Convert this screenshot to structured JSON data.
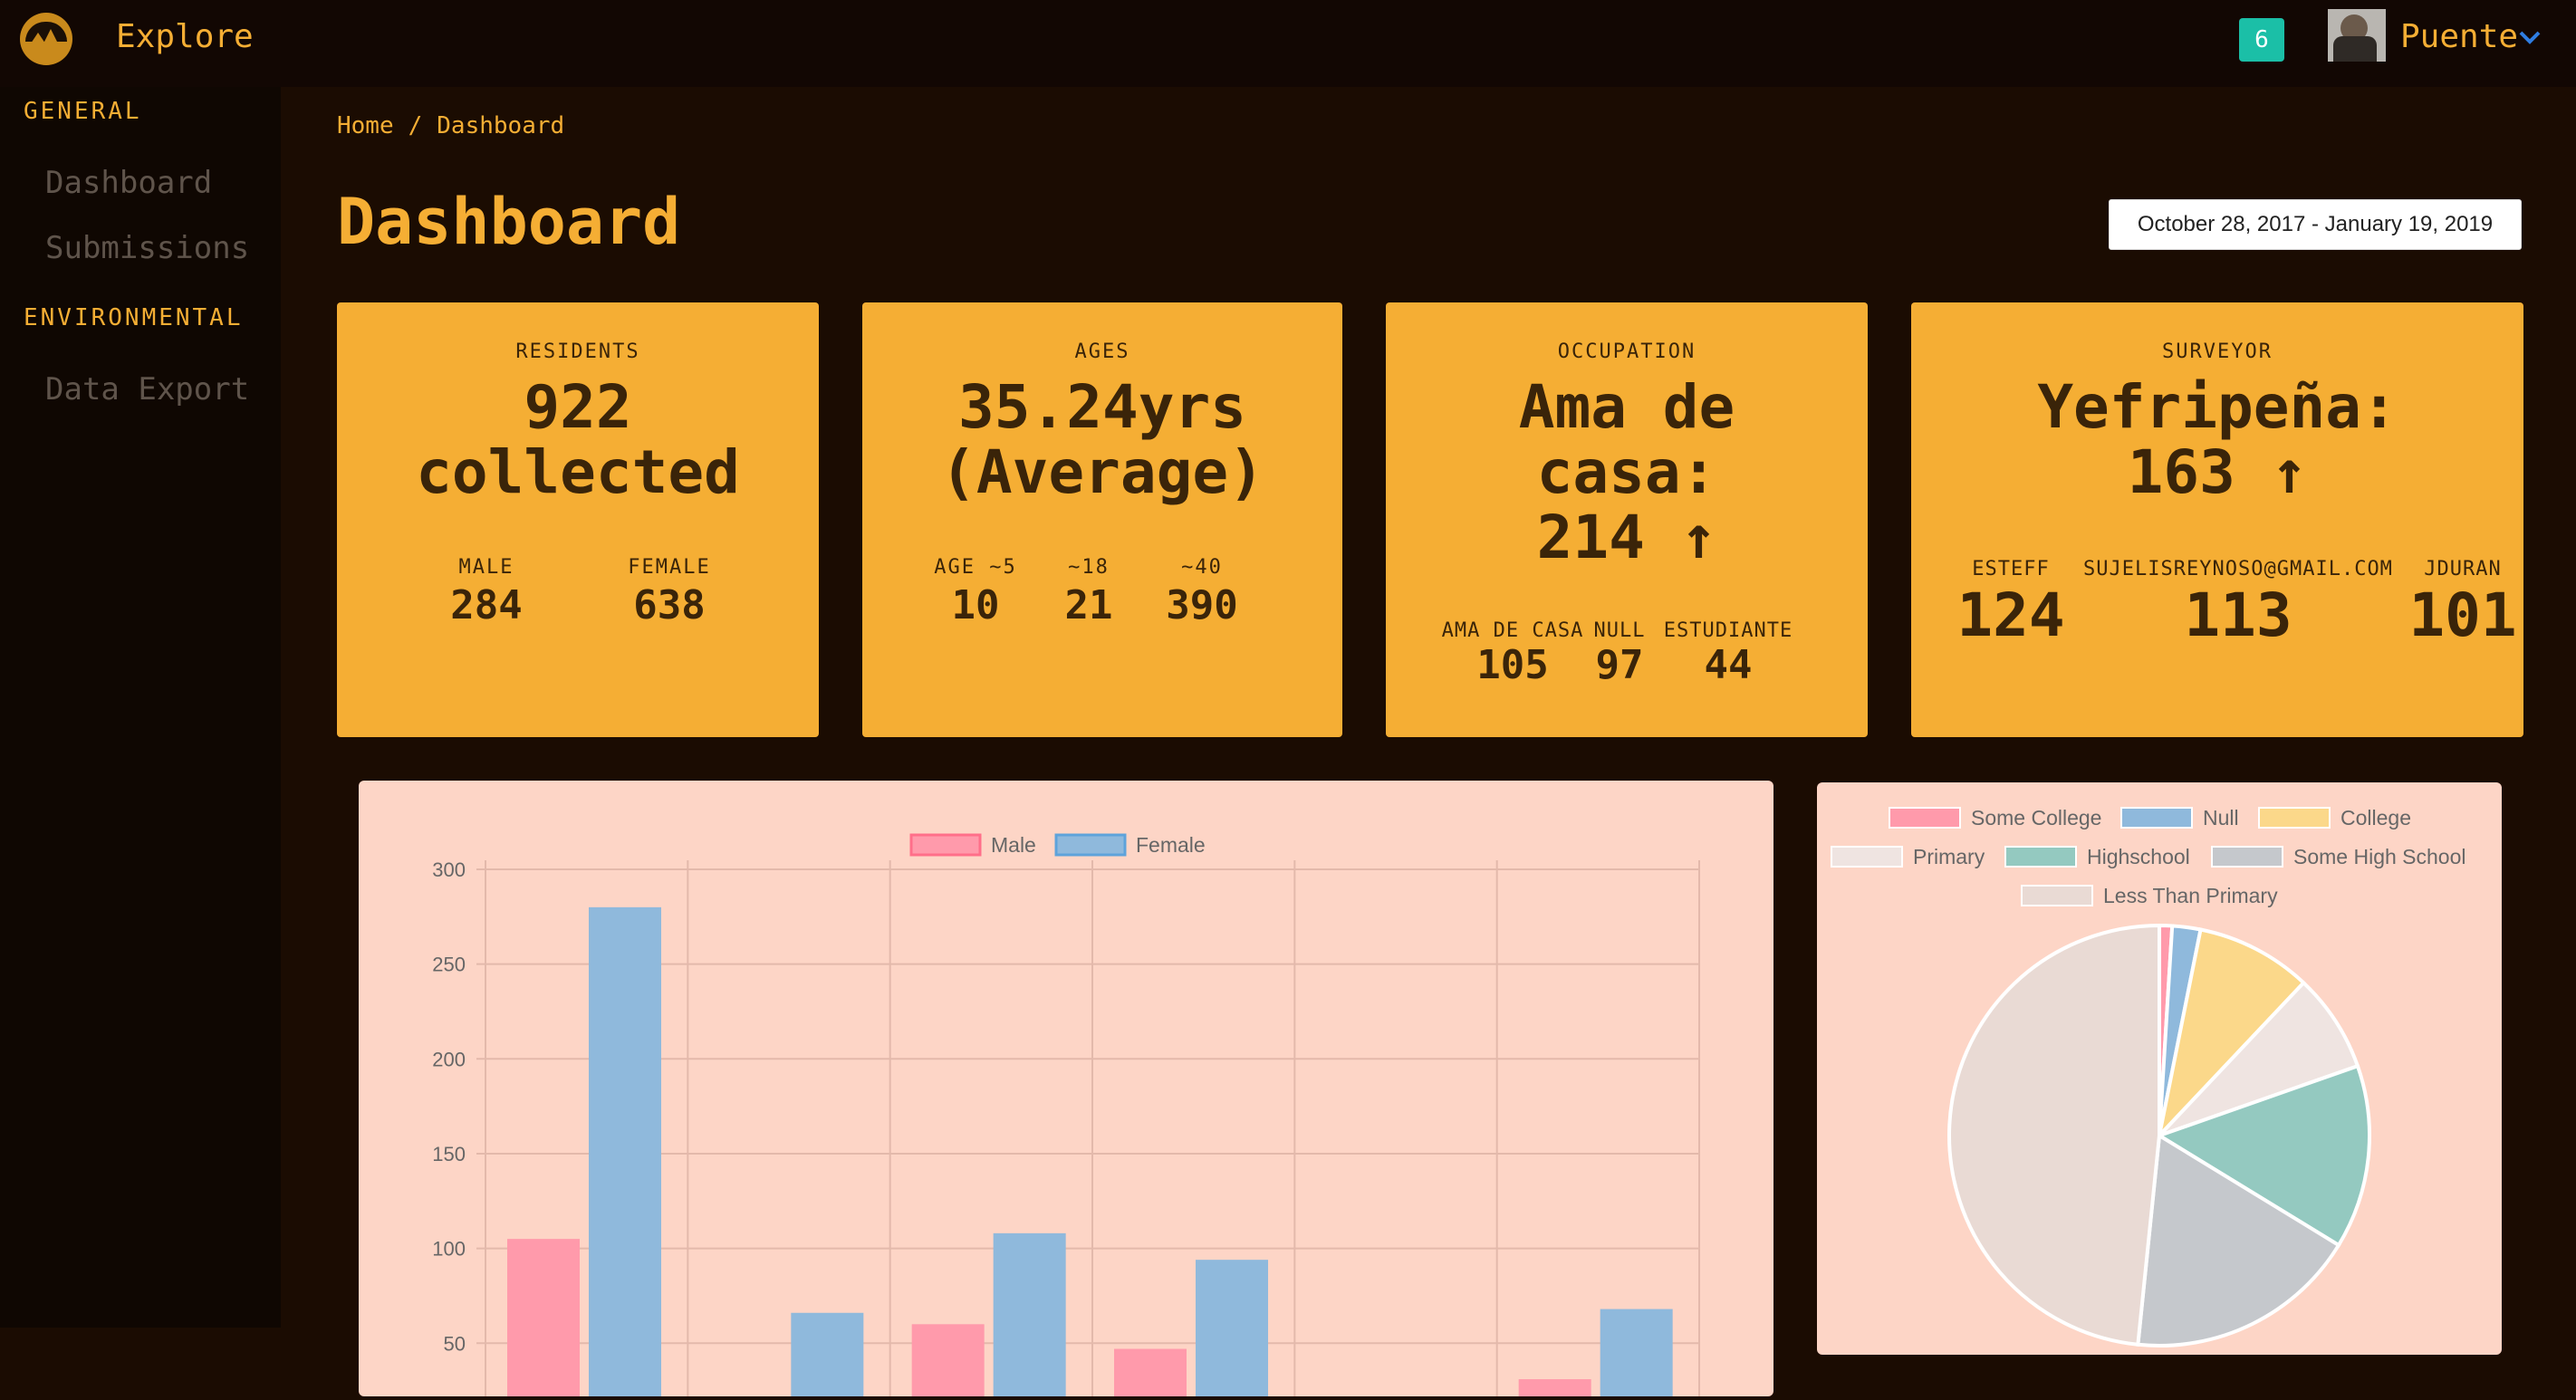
{
  "header": {
    "brand": "Explore",
    "notification_count": "6",
    "username": "Puente"
  },
  "sidebar": {
    "sections": [
      {
        "title": "GENERAL",
        "items": [
          "Dashboard",
          "Submissions"
        ]
      },
      {
        "title": "ENVIRONMENTAL",
        "items": [
          "Data Export"
        ]
      }
    ]
  },
  "breadcrumb": {
    "home": "Home",
    "separator": "/",
    "current": "Dashboard"
  },
  "page": {
    "title": "Dashboard",
    "date_range": "October 28, 2017 - January 19, 2019"
  },
  "cards": {
    "residents": {
      "label": "RESIDENTS",
      "value_line1": "922",
      "value_line2": "collected",
      "subs": [
        {
          "label": "MALE",
          "value": "284"
        },
        {
          "label": "FEMALE",
          "value": "638"
        }
      ]
    },
    "ages": {
      "label": "AGES",
      "value_line1": "35.24yrs",
      "value_line2": "(Average)",
      "subs": [
        {
          "label": "AGE ~5",
          "value": "10"
        },
        {
          "label": "~18",
          "value": "21"
        },
        {
          "label": "~40",
          "value": "390"
        }
      ]
    },
    "occupation": {
      "label": "OCCUPATION",
      "value_line1": "Ama de",
      "value_line2": "casa:",
      "value_line3": "214 ↑",
      "subs": [
        {
          "label": "AMA DE CASA",
          "value": "105"
        },
        {
          "label": "NULL",
          "value": "97"
        },
        {
          "label": "ESTUDIANTE",
          "value": "44"
        }
      ]
    },
    "surveyor": {
      "label": "SURVEYOR",
      "value_line1": "Yefripeña:",
      "value_line2": "163 ↑",
      "subs": [
        {
          "label": "ESTEFF",
          "value": "124"
        },
        {
          "label": "SUJELISREYNOSO@GMAIL.COM",
          "value": "113"
        },
        {
          "label": "JDURAN",
          "value": "101"
        }
      ]
    }
  },
  "colors": {
    "accent": "#f5ae34",
    "background": "#1b0c02",
    "panel": "#fdd5c6",
    "male": "#ff9aab",
    "female": "#8fb9dc",
    "notification": "#1bbfa7"
  },
  "chart_data": [
    {
      "type": "bar",
      "categories": [
        "",
        "",
        "",
        "",
        "",
        ""
      ],
      "series": [
        {
          "name": "Male",
          "values": [
            105,
            7,
            60,
            47,
            0,
            31
          ]
        },
        {
          "name": "Female",
          "values": [
            280,
            66,
            108,
            94,
            0,
            68
          ]
        }
      ],
      "y_ticks": [
        50,
        100,
        150,
        200,
        250,
        300
      ],
      "ylim": [
        0,
        300
      ],
      "grid": true,
      "legend": "top"
    },
    {
      "type": "pie",
      "labels": [
        "Some College",
        "Null",
        "College",
        "Primary",
        "Highschool",
        "Some High School",
        "Less Than Primary"
      ],
      "values": [
        9,
        20,
        82,
        70,
        130,
        165,
        446
      ],
      "colors": [
        "#ff9aab",
        "#8fb9dc",
        "#fbd88a",
        "#efe4e1",
        "#94c9c0",
        "#c5c8cc",
        "#e9dad4"
      ],
      "legend": "top"
    }
  ]
}
